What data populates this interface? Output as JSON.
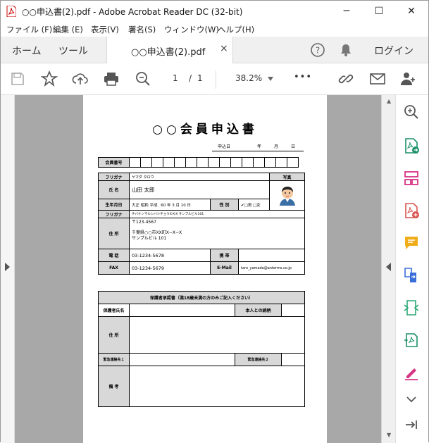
{
  "window": {
    "title": "○○申込書(2).pdf - Adobe Acrobat Reader DC (32-bit)",
    "minimize": "─",
    "maximize": "☐",
    "close": "✕"
  },
  "menu": [
    "ファイル (F)",
    "編集 (E)",
    "表示(V)",
    "署名(S)",
    "ウィンドウ(W)",
    "ヘルプ(H)"
  ],
  "tabs": {
    "home": "ホーム",
    "tools": "ツール",
    "document": "○○申込書(2).pdf",
    "close": "×",
    "login": "ログイン"
  },
  "toolbar": {
    "page_current": "1",
    "page_sep": "/",
    "page_total": "1",
    "zoom": "38.2%",
    "more": "•••"
  },
  "form": {
    "title": "○○会員申込書",
    "apply_label": "申込日",
    "year": "年",
    "month": "月",
    "day": "日",
    "member_no_label": "会員番号",
    "furigana_label": "フリガナ",
    "furigana_value": "ヤマダ タロウ",
    "photo_label": "写真",
    "name_label": "氏 名",
    "name_value": "山田 太郎",
    "birth_label": "生年月日",
    "era_options": "大正 昭和 平成",
    "birth_value": "60 年 3 月 10 日",
    "gender_label": "性 別",
    "gender_male": "男",
    "gender_female": "女",
    "addr_furigana": "チバケンマルシバシチョウX-X-X サンプルビル101",
    "address_label": "住 所",
    "postal": "〒123-4567",
    "address_line1": "千葉県○○市XX町X−X−X",
    "address_line2": "サンプルビル 101",
    "phone_label": "電 話",
    "phone_value": "03-1234-5678",
    "mobile_label": "携 帯",
    "fax_label": "FAX",
    "fax_value": "03-1234-5679",
    "email_label": "E-Mail",
    "email_value": "taro_yamada@anterms.co.jp",
    "guardian_header": "保護者承認書（満18歳未満の方のみご記入ください）",
    "guardian_name_label": "保護者氏名",
    "relation_label": "本人との続柄",
    "guardian_address_label": "住 所",
    "emergency1_label": "緊急連絡先１",
    "emergency2_label": "緊急連絡先２",
    "remarks_label": "備 考"
  }
}
